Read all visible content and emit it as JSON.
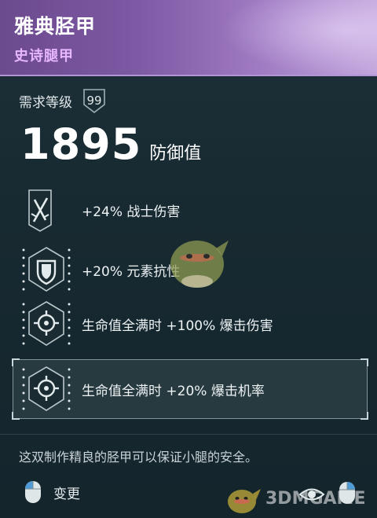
{
  "item": {
    "name": "雅典胫甲",
    "rarity": "史诗腿甲"
  },
  "requirement": {
    "label": "需求等级",
    "level": "99"
  },
  "defense": {
    "value": "1895",
    "label": "防御值"
  },
  "perks": [
    {
      "icon": "dagger-icon",
      "text": "+24% 战士伤害",
      "highlighted": false
    },
    {
      "icon": "shield-icon",
      "text": "+20% 元素抗性",
      "highlighted": false
    },
    {
      "icon": "crosshair-icon",
      "text": "生命值全满时 +100% 爆击伤害",
      "highlighted": false
    },
    {
      "icon": "crosshair-icon",
      "text": "生命值全满时 +20% 爆击机率",
      "highlighted": true
    }
  ],
  "flavor_text": "这双制作精良的胫甲可以保证小腿的安全。",
  "footer": {
    "change_label": "变更"
  },
  "watermark": "3DMGAME",
  "colors": {
    "rarity_epic": "#e6b6ff",
    "header_purple": "#7d58a3",
    "panel_bg": "#182a31"
  }
}
